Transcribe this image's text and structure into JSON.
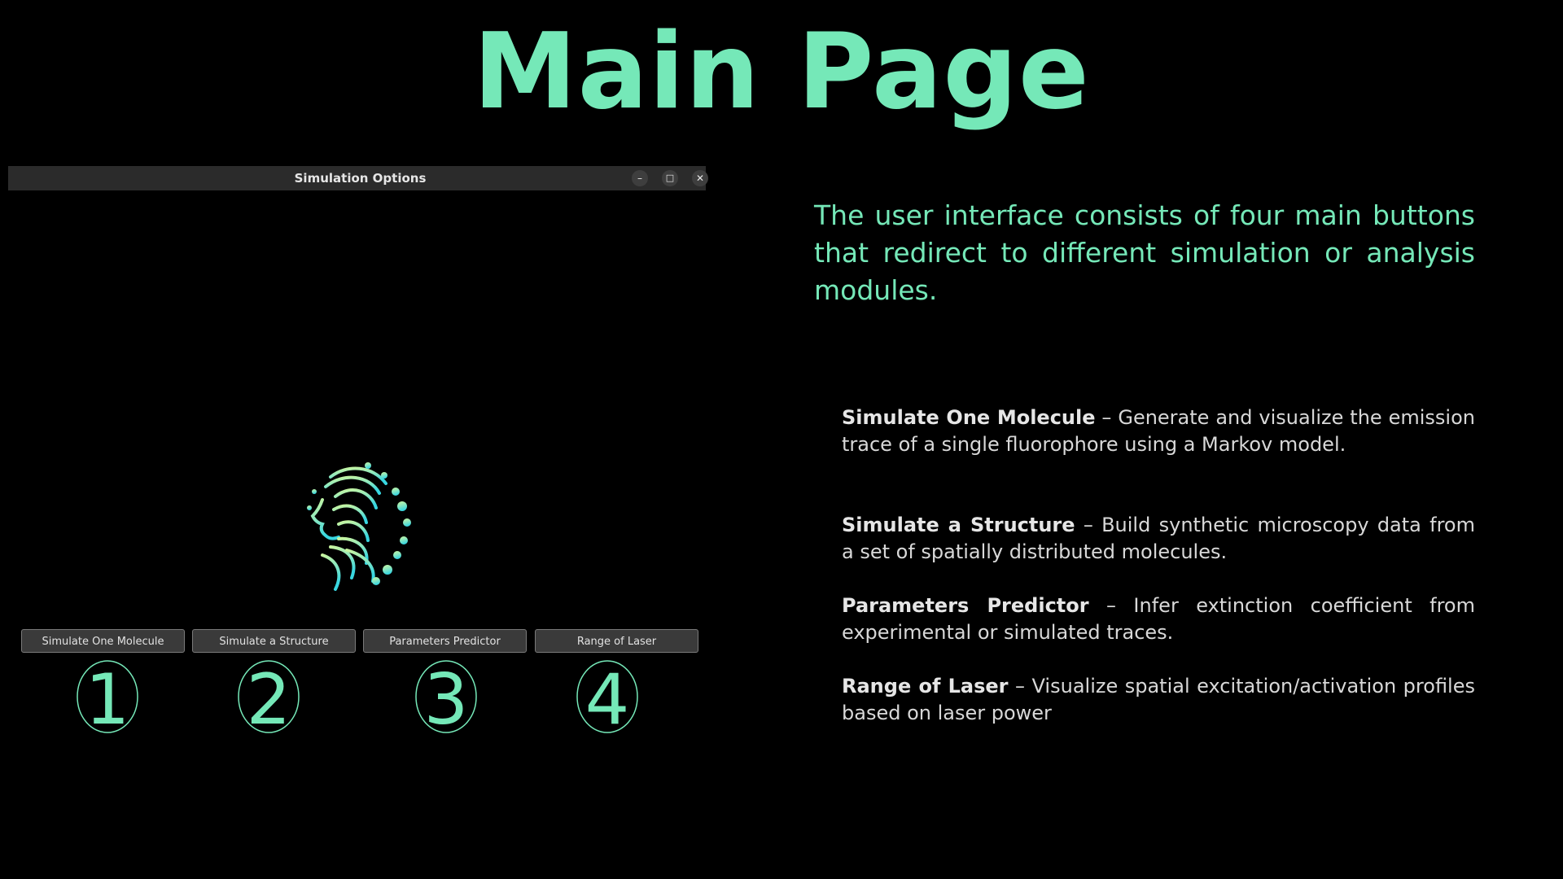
{
  "slide": {
    "title": "Main Page"
  },
  "window": {
    "title": "Simulation Options",
    "controls": {
      "minimize": "–",
      "maximize": "□",
      "close": "✕"
    },
    "logo_icon": "lion-logo",
    "buttons": [
      {
        "label": "Simulate One Molecule",
        "number": "1"
      },
      {
        "label": "Simulate a Structure",
        "number": "2"
      },
      {
        "label": "Parameters Predictor",
        "number": "3"
      },
      {
        "label": "Range of Laser",
        "number": "4"
      }
    ]
  },
  "description": {
    "intro": "The user interface consists of four main buttons that redirect to different simulation or analysis modules.",
    "items": [
      {
        "name": "Simulate One Molecule",
        "text": " – Generate and visualize the emission trace of a single fluorophore using a Markov model."
      },
      {
        "name": "Simulate a Structure",
        "text": " – Build synthetic microscopy data from a set of spatially distributed molecules."
      },
      {
        "name": "Parameters Predictor",
        "text": " – Infer extinction coefficient from experimental or simulated traces."
      },
      {
        "name": "Range of Laser",
        "text": " – Visualize spatial excitation/activation profiles based on laser power"
      }
    ]
  },
  "colors": {
    "accent": "#75e8b8",
    "background": "#000000",
    "titlebar": "#2b2b2b",
    "button": "#3a3a3a"
  }
}
